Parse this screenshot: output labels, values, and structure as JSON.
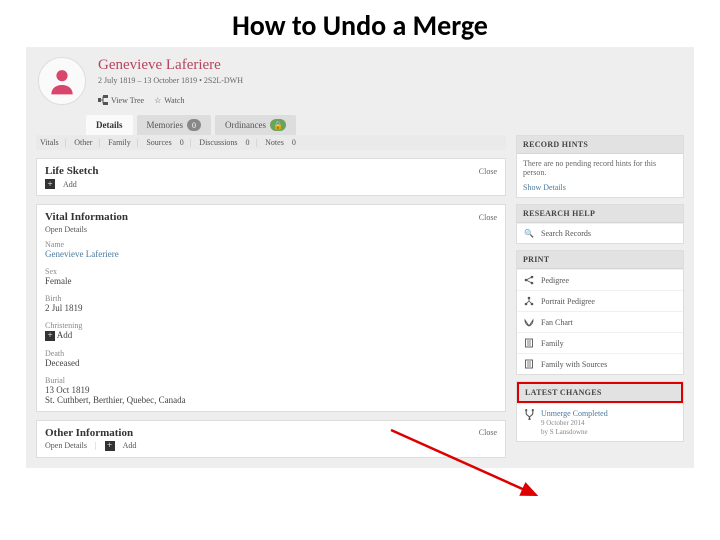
{
  "slide_title": "How to Undo a Merge",
  "person": {
    "name": "Genevieve Laferiere",
    "dates": "2 July 1819 – 13 October 1819 • 2S2L-DWH",
    "view_tree": "View Tree",
    "watch": "Watch"
  },
  "tabs": {
    "details": "Details",
    "memories": "Memories",
    "memories_count": "0",
    "ordinances": "Ordinances"
  },
  "section_nav": {
    "vitals": "Vitals",
    "other": "Other",
    "family": "Family",
    "sources": "Sources",
    "sources_count": "0",
    "discussions": "Discussions",
    "discussions_count": "0",
    "notes": "Notes",
    "notes_count": "0"
  },
  "life_sketch": {
    "title": "Life Sketch",
    "add": "Add",
    "close": "Close"
  },
  "vital_info": {
    "title": "Vital Information",
    "open_details": "Open Details",
    "add": "Add",
    "close": "Close",
    "fields": {
      "name_label": "Name",
      "name_value": "Genevieve Laferiere",
      "sex_label": "Sex",
      "sex_value": "Female",
      "birth_label": "Birth",
      "birth_value": "2 Jul 1819",
      "christening_label": "Christening",
      "christening_value": "Add",
      "death_label": "Death",
      "death_value": "Deceased",
      "burial_label": "Burial",
      "burial_value": "13 Oct 1819",
      "burial_place": "St. Cuthbert, Berthier, Quebec, Canada"
    }
  },
  "other_info": {
    "title": "Other Information",
    "open_details": "Open Details",
    "add": "Add",
    "close": "Close"
  },
  "record_hints": {
    "title": "RECORD HINTS",
    "body": "There are no pending record hints for this person.",
    "show_details": "Show Details"
  },
  "research_help": {
    "title": "RESEARCH HELP",
    "search_records": "Search Records"
  },
  "print": {
    "title": "PRINT",
    "items": {
      "pedigree": "Pedigree",
      "portrait_pedigree": "Portrait Pedigree",
      "fan_chart": "Fan Chart",
      "family": "Family",
      "family_with_sources": "Family with Sources"
    }
  },
  "latest_changes": {
    "title": "LATEST CHANGES",
    "items": [
      {
        "title": "Unmerge Completed",
        "date": "9 October 2014",
        "by": "by S Lansdowne"
      }
    ]
  }
}
